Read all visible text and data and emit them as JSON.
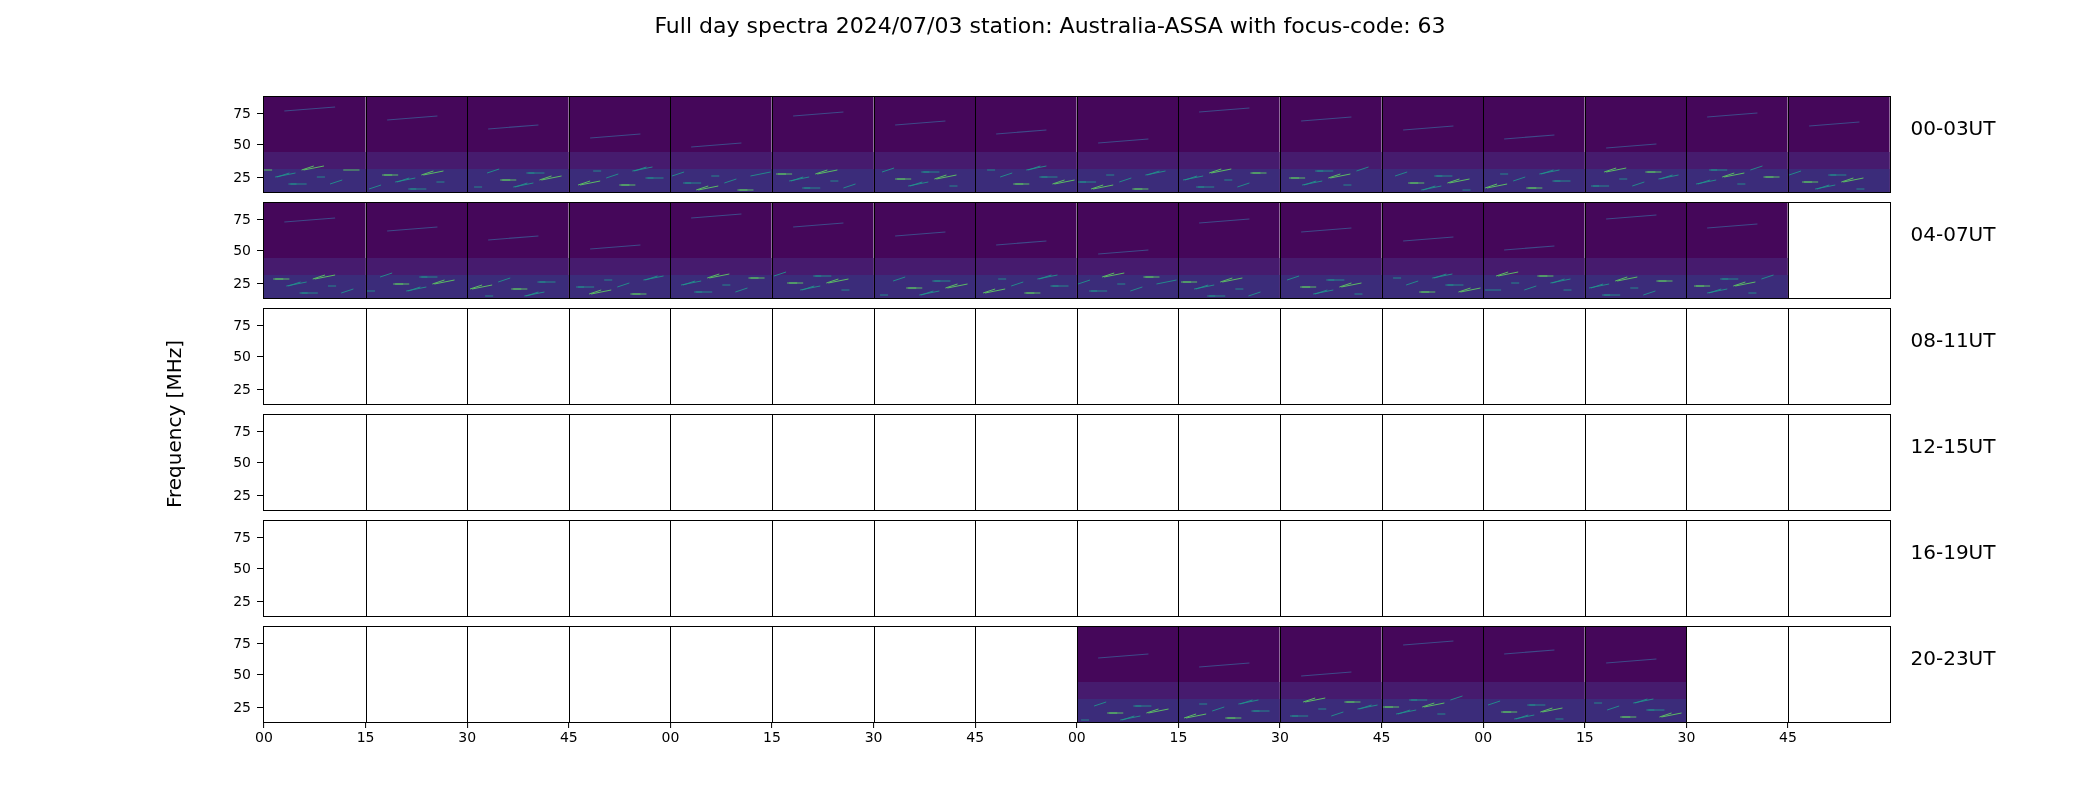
{
  "title": "Full day spectra 2024/07/03 station: Australia-ASSA with focus-code: 63",
  "ylabel": "Frequency [MHz]",
  "rows": [
    {
      "label": "00-03UT",
      "yticks": [
        "75",
        "50",
        "25"
      ],
      "panels": [
        {
          "filled": true
        },
        {
          "filled": true
        },
        {
          "filled": true
        },
        {
          "filled": true
        },
        {
          "filled": true
        },
        {
          "filled": true
        },
        {
          "filled": true
        },
        {
          "filled": true
        },
        {
          "filled": true
        },
        {
          "filled": true
        },
        {
          "filled": true
        },
        {
          "filled": true
        },
        {
          "filled": true
        },
        {
          "filled": true
        },
        {
          "filled": true
        },
        {
          "filled": true
        }
      ]
    },
    {
      "label": "04-07UT",
      "yticks": [
        "75",
        "50",
        "25"
      ],
      "panels": [
        {
          "filled": true
        },
        {
          "filled": true
        },
        {
          "filled": true
        },
        {
          "filled": true
        },
        {
          "filled": true
        },
        {
          "filled": true
        },
        {
          "filled": true
        },
        {
          "filled": true
        },
        {
          "filled": true
        },
        {
          "filled": true
        },
        {
          "filled": true
        },
        {
          "filled": true
        },
        {
          "filled": true
        },
        {
          "filled": true
        },
        {
          "filled": true
        },
        {
          "filled": false
        }
      ]
    },
    {
      "label": "08-11UT",
      "yticks": [
        "75",
        "50",
        "25"
      ],
      "panels": [
        {
          "filled": false
        },
        {
          "filled": false
        },
        {
          "filled": false
        },
        {
          "filled": false
        },
        {
          "filled": false
        },
        {
          "filled": false
        },
        {
          "filled": false
        },
        {
          "filled": false
        },
        {
          "filled": false
        },
        {
          "filled": false
        },
        {
          "filled": false
        },
        {
          "filled": false
        },
        {
          "filled": false
        },
        {
          "filled": false
        },
        {
          "filled": false
        },
        {
          "filled": false
        }
      ]
    },
    {
      "label": "12-15UT",
      "yticks": [
        "75",
        "50",
        "25"
      ],
      "panels": [
        {
          "filled": false
        },
        {
          "filled": false
        },
        {
          "filled": false
        },
        {
          "filled": false
        },
        {
          "filled": false
        },
        {
          "filled": false
        },
        {
          "filled": false
        },
        {
          "filled": false
        },
        {
          "filled": false
        },
        {
          "filled": false
        },
        {
          "filled": false
        },
        {
          "filled": false
        },
        {
          "filled": false
        },
        {
          "filled": false
        },
        {
          "filled": false
        },
        {
          "filled": false
        }
      ]
    },
    {
      "label": "16-19UT",
      "yticks": [
        "75",
        "50",
        "25"
      ],
      "panels": [
        {
          "filled": false
        },
        {
          "filled": false
        },
        {
          "filled": false
        },
        {
          "filled": false
        },
        {
          "filled": false
        },
        {
          "filled": false
        },
        {
          "filled": false
        },
        {
          "filled": false
        },
        {
          "filled": false
        },
        {
          "filled": false
        },
        {
          "filled": false
        },
        {
          "filled": false
        },
        {
          "filled": false
        },
        {
          "filled": false
        },
        {
          "filled": false
        },
        {
          "filled": false
        }
      ]
    },
    {
      "label": "20-23UT",
      "yticks": [
        "75",
        "50",
        "25"
      ],
      "panels": [
        {
          "filled": false
        },
        {
          "filled": false
        },
        {
          "filled": false
        },
        {
          "filled": false
        },
        {
          "filled": false
        },
        {
          "filled": false
        },
        {
          "filled": false
        },
        {
          "filled": false
        },
        {
          "filled": true
        },
        {
          "filled": true
        },
        {
          "filled": true
        },
        {
          "filled": true
        },
        {
          "filled": true
        },
        {
          "filled": true
        },
        {
          "filled": false
        },
        {
          "filled": false
        }
      ]
    }
  ],
  "xticks": [
    "00",
    "15",
    "30",
    "45",
    "00",
    "15",
    "30",
    "45",
    "00",
    "15",
    "30",
    "45",
    "00",
    "15",
    "30",
    "45"
  ]
}
